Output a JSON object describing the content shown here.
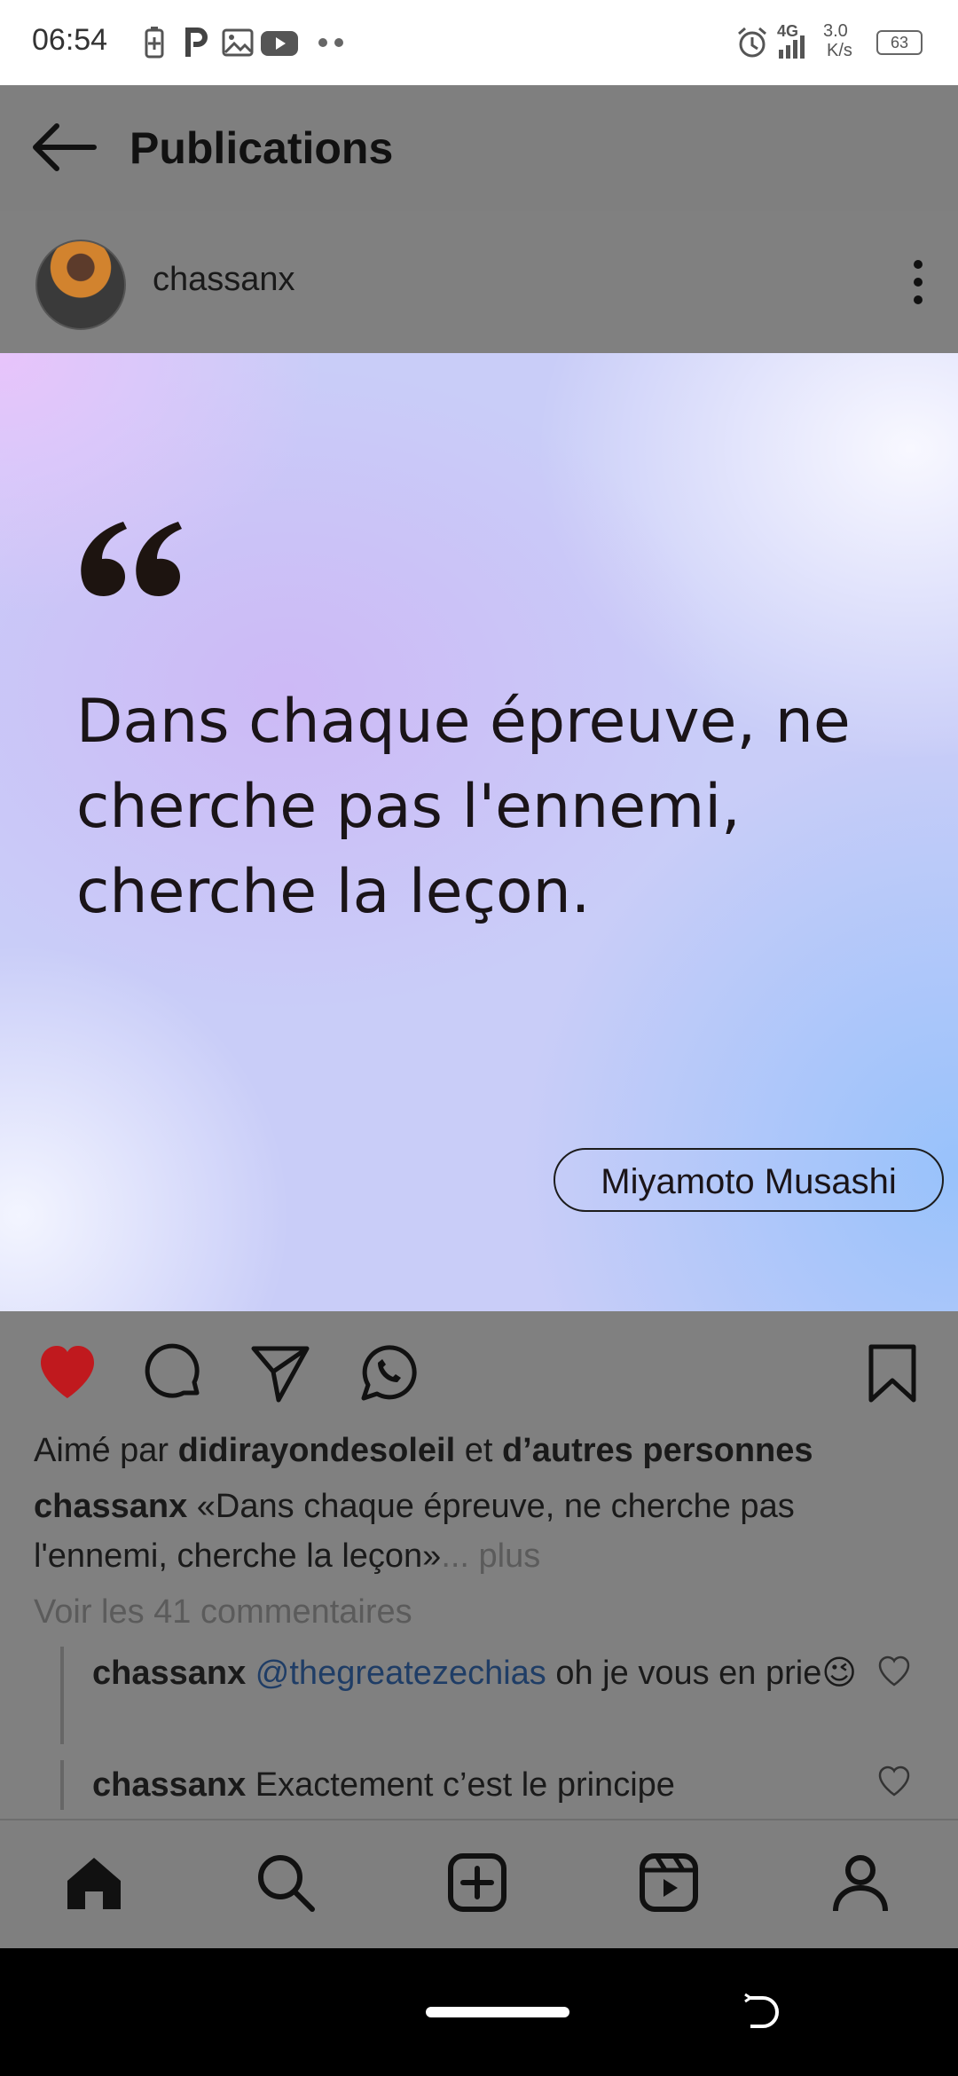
{
  "status_bar": {
    "time": "06:54",
    "network": "4G",
    "speed_value": "3.0",
    "speed_unit": "K/s",
    "battery": "63",
    "icons": [
      "battery-saver-icon",
      "p-app-icon",
      "gallery-icon",
      "youtube-icon",
      "more-dots-icon",
      "alarm-icon",
      "signal-icon",
      "battery-icon"
    ]
  },
  "header": {
    "title": "Publications"
  },
  "post": {
    "username": "chassanx",
    "quote_text": "Dans chaque épreuve, ne cherche pas l'ennemi, cherche la leçon.",
    "author": "Miyamoto Musashi",
    "liked": true,
    "likes": {
      "prefix": "Aimé par ",
      "user": "didirayondesoleil",
      "middle": " et ",
      "others": "d’autres personnes"
    },
    "caption": {
      "user": "chassanx",
      "text": " «Dans chaque épreuve, ne cherche pas l'ennemi, cherche la leçon»",
      "more": "... plus"
    },
    "view_comments": "Voir les 41 commentaires",
    "comments": [
      {
        "user": "chassanx",
        "mention": "@thegreatezechias",
        "text": " oh je vous en prie",
        "emoji": "😉"
      },
      {
        "user": "chassanx",
        "mention": "",
        "text": " Exactement c’est le principe",
        "emoji": ""
      }
    ]
  },
  "colors": {
    "overlay_gray": "#808080",
    "like_red": "#c0191e",
    "mention_blue": "#1f3d66"
  },
  "bottom_nav": [
    "home-icon",
    "search-icon",
    "create-icon",
    "reels-icon",
    "profile-icon"
  ]
}
